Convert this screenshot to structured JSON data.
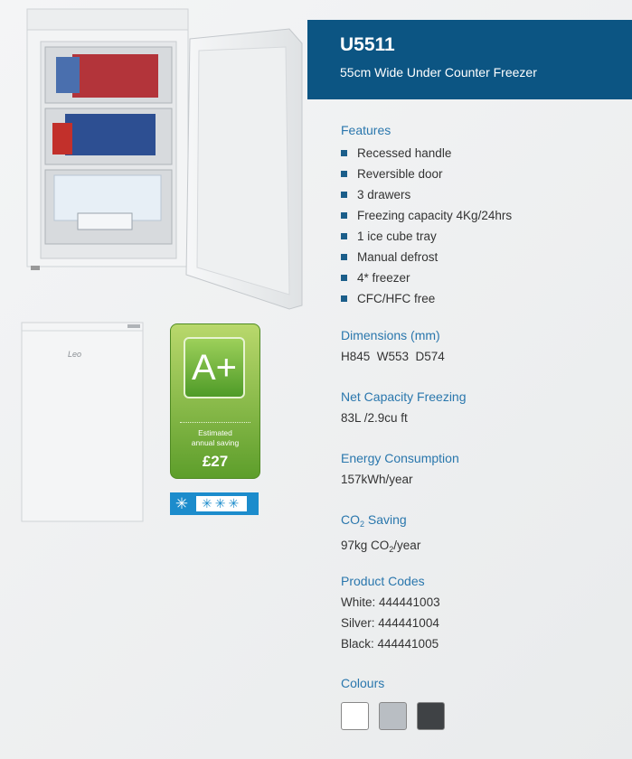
{
  "product": {
    "model": "U5511",
    "subtitle": "55cm Wide Under Counter Freezer"
  },
  "features": {
    "heading": "Features",
    "items": [
      "Recessed handle",
      "Reversible door",
      "3 drawers",
      "Freezing capacity 4Kg/24hrs",
      "1 ice cube tray",
      "Manual defrost",
      "4* freezer",
      "CFC/HFC free"
    ]
  },
  "dimensions": {
    "heading": "Dimensions (mm)",
    "value": "H845  W553  D574"
  },
  "capacity": {
    "heading": "Net Capacity Freezing",
    "value": "83L /2.9cu ft"
  },
  "energy": {
    "heading": "Energy Consumption",
    "value": "157kWh/year"
  },
  "co2": {
    "heading_prefix": "CO",
    "heading_sub": "2",
    "heading_suffix": " Saving",
    "value_prefix": "97kg CO",
    "value_sub": "2",
    "value_suffix": "/year"
  },
  "codes": {
    "heading": "Product Codes",
    "items": [
      "White: 444441003",
      "Silver: 444441004",
      "Black: 444441005"
    ]
  },
  "colours": {
    "heading": "Colours",
    "swatches": [
      "#ffffff",
      "#b9bec3",
      "#3f4245"
    ]
  },
  "badge": {
    "rating": "A+",
    "label_line1": "Estimated",
    "label_line2": "annual saving",
    "amount": "£27"
  },
  "brand_mark": "Leo",
  "colors": {
    "title_band": "#0c5583",
    "heading": "#2a77ad"
  }
}
